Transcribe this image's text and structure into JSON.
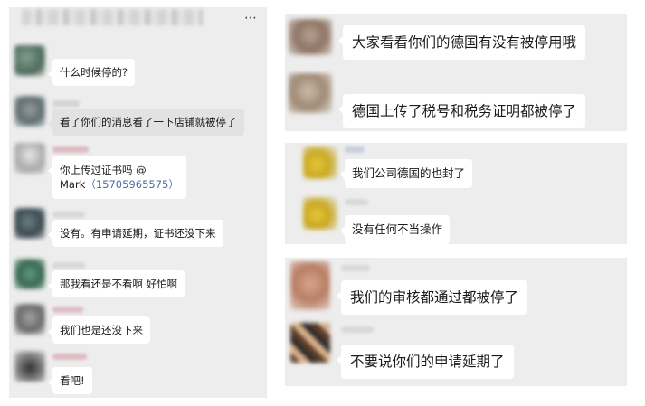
{
  "left_chat": {
    "messages": [
      {
        "text": "什么时候停的?"
      },
      {
        "text": "看了你们的消息看了一下店铺就被停了"
      },
      {
        "line1": "你上传过证书吗 @",
        "line2_mention": "Mark",
        "line2_phone": "（15705965575）"
      },
      {
        "text": "没有。有申请延期，证书还没下来"
      },
      {
        "text": "那我看还是不看啊 好怕啊"
      },
      {
        "text": "我们也是还没下来"
      },
      {
        "text": "看吧!"
      }
    ]
  },
  "right_chat_1": {
    "messages": [
      {
        "text": "大家看看你们的德国有没有被停用哦"
      },
      {
        "text": "德国上传了税号和税务证明都被停了"
      }
    ]
  },
  "right_chat_2": {
    "messages": [
      {
        "text": "我们公司德国的也封了"
      },
      {
        "text": "没有任何不当操作"
      }
    ]
  },
  "right_chat_3": {
    "messages": [
      {
        "text": "我们的审核都通过都被停了"
      },
      {
        "text": "不要说你们的申请延期了"
      }
    ]
  },
  "icons": {
    "more": "⋯"
  }
}
